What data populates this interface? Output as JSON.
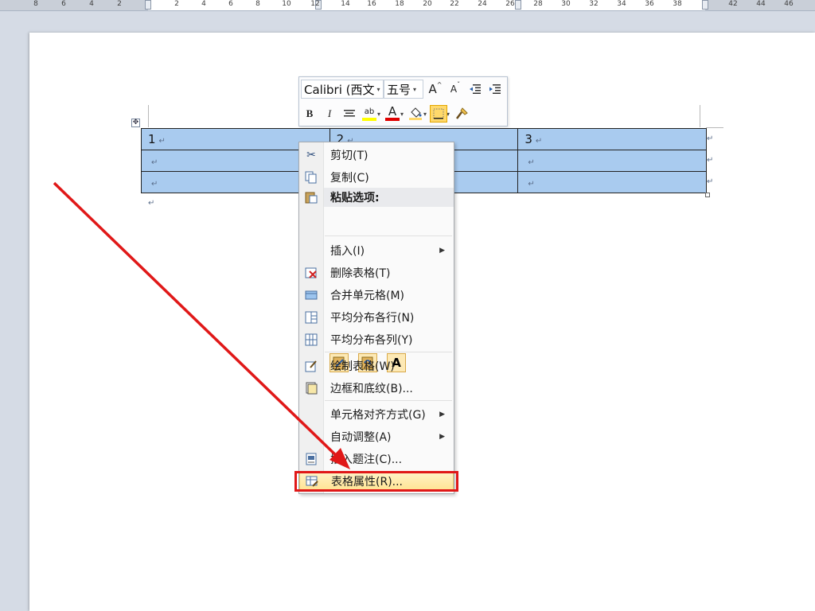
{
  "ruler": {
    "labels": [
      "8",
      "6",
      "4",
      "2",
      "2",
      "4",
      "6",
      "8",
      "10",
      "12",
      "14",
      "16",
      "18",
      "20",
      "22",
      "24",
      "26",
      "28",
      "30",
      "32",
      "34",
      "36",
      "38",
      "42",
      "44",
      "46"
    ]
  },
  "mini_toolbar": {
    "font_name": "Calibri (西文",
    "font_size": "五号",
    "grow_font_label": "A",
    "shrink_font_label": "A",
    "bold_label": "B",
    "italic_label": "I",
    "highlight_label": "ab",
    "font_color_label": "A",
    "colors": {
      "highlight": "#ffff00",
      "font_color": "#e00000",
      "shading_active": "#ffd96b"
    }
  },
  "table": {
    "rows": [
      [
        "1",
        "2",
        "3"
      ],
      [
        "",
        "",
        ""
      ],
      [
        "",
        "",
        ""
      ]
    ],
    "paragraph_mark": "↵"
  },
  "context_menu": {
    "items": [
      {
        "label": "剪切(T)",
        "icon": "scissors-icon"
      },
      {
        "label": "复制(C)",
        "icon": "copy-icon"
      },
      {
        "label": "粘贴选项:",
        "icon": "paste-icon"
      },
      {
        "label": "插入(I)",
        "icon": ""
      },
      {
        "label": "删除表格(T)",
        "icon": "delete-table-icon"
      },
      {
        "label": "合并单元格(M)",
        "icon": "merge-cells-icon"
      },
      {
        "label": "平均分布各行(N)",
        "icon": "distribute-rows-icon"
      },
      {
        "label": "平均分布各列(Y)",
        "icon": "distribute-columns-icon"
      },
      {
        "label": "绘制表格(W)",
        "icon": "draw-table-icon"
      },
      {
        "label": "边框和底纹(B)...",
        "icon": "borders-icon"
      },
      {
        "label": "单元格对齐方式(G)",
        "icon": ""
      },
      {
        "label": "自动调整(A)",
        "icon": ""
      },
      {
        "label": "插入题注(C)...",
        "icon": "caption-icon"
      },
      {
        "label": "表格属性(R)...",
        "icon": "table-properties-icon"
      }
    ],
    "paste_text_only_label": "A"
  },
  "annotation": {
    "highlight_color": "#e01818"
  }
}
